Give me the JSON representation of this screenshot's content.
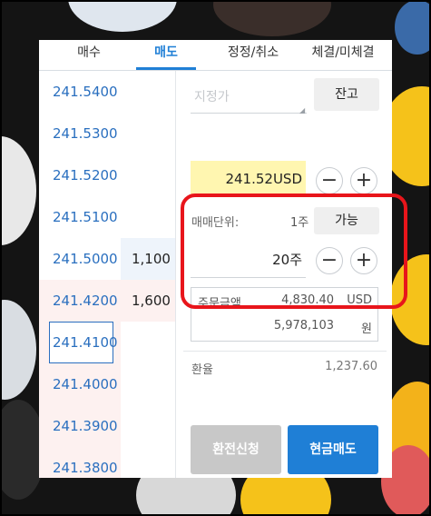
{
  "tabs": [
    "매수",
    "매도",
    "정정/취소",
    "체결/미체결"
  ],
  "active_tab": "매도",
  "order_book": [
    {
      "price": "241.5400",
      "qty": "",
      "side": "buy"
    },
    {
      "price": "241.5300",
      "qty": "",
      "side": "buy"
    },
    {
      "price": "241.5200",
      "qty": "",
      "side": "buy"
    },
    {
      "price": "241.5100",
      "qty": "",
      "side": "buy"
    },
    {
      "price": "241.5000",
      "qty": "1,100",
      "side": "buy"
    },
    {
      "price": "241.4200",
      "qty": "1,600",
      "side": "sell"
    },
    {
      "price": "241.4100",
      "qty": "",
      "side": "sell"
    },
    {
      "price": "241.4000",
      "qty": "",
      "side": "sell"
    },
    {
      "price": "241.3900",
      "qty": "",
      "side": "sell"
    },
    {
      "price": "241.3800",
      "qty": "",
      "side": "sell"
    }
  ],
  "order_form": {
    "price_type_placeholder": "지정가",
    "balance_button": "잔고",
    "price_value": "241.52USD",
    "unit_label": "매매단위:",
    "unit_value": "1주",
    "available_button": "가능",
    "quantity_value": "20주",
    "amount_label": "주문금액",
    "amount_usd": "4,830.40",
    "usd_unit": "USD",
    "amount_krw": "5,978,103",
    "krw_unit": "원",
    "exchange_label": "환율",
    "exchange_value": "1,237.60",
    "minus_symbol": "−",
    "plus_symbol": "+"
  },
  "buttons": {
    "exchange_request": "환전신청",
    "cash_sell": "현금매도"
  },
  "colors": {
    "accent_blue": "#1f7fd6",
    "highlight_yellow": "#fff6b0",
    "annotation_red": "#e8151b"
  }
}
